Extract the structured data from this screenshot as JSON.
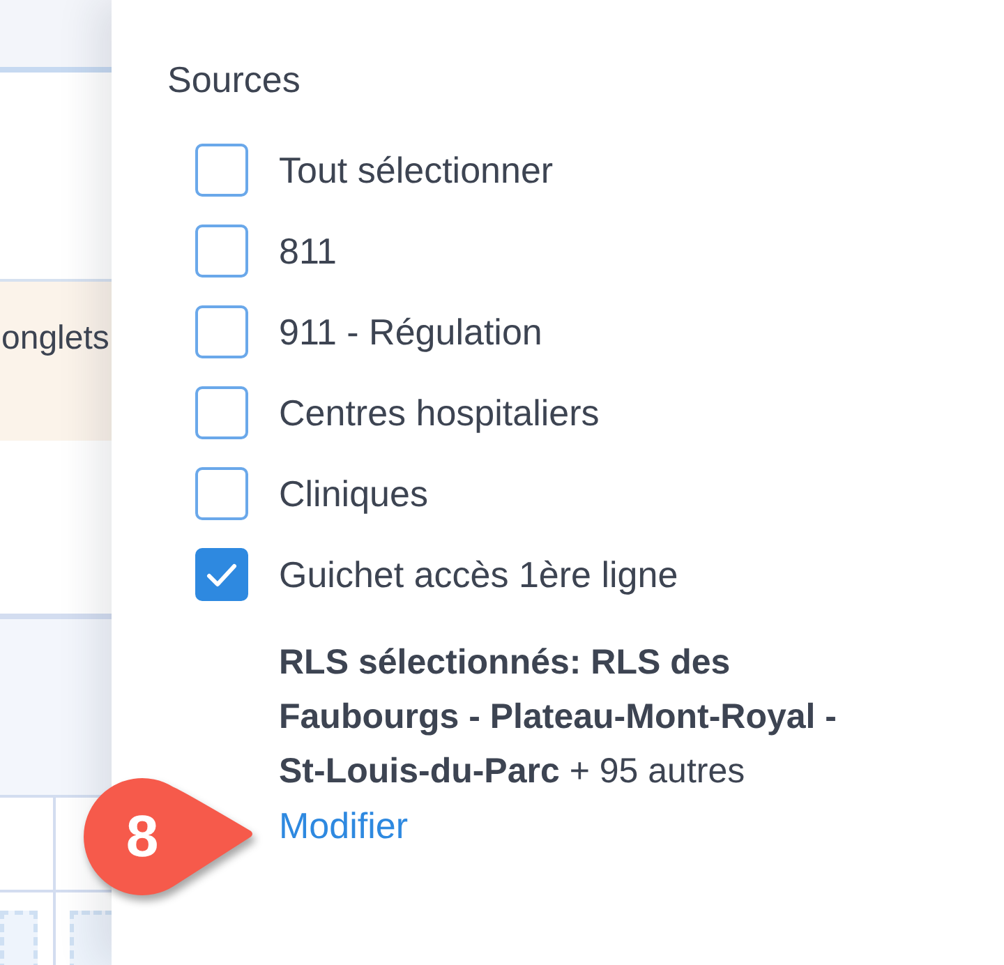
{
  "background_page": {
    "notice_text": "onglets"
  },
  "sources": {
    "title": "Sources",
    "options": [
      {
        "label": "Tout sélectionner",
        "checked": false
      },
      {
        "label": "811",
        "checked": false
      },
      {
        "label": "911 - Régulation",
        "checked": false
      },
      {
        "label": "Centres hospitaliers",
        "checked": false
      },
      {
        "label": "Cliniques",
        "checked": false
      },
      {
        "label": "Guichet accès 1ère ligne",
        "checked": true
      }
    ],
    "rls_summary": "**RLS sélectionnés: RLS des Faubourgs - Plateau-Mont-Royal - St-Louis-du-Parc** + 95 autres",
    "edit_link": "Modifier"
  },
  "callout_badge": {
    "number": "8"
  }
}
